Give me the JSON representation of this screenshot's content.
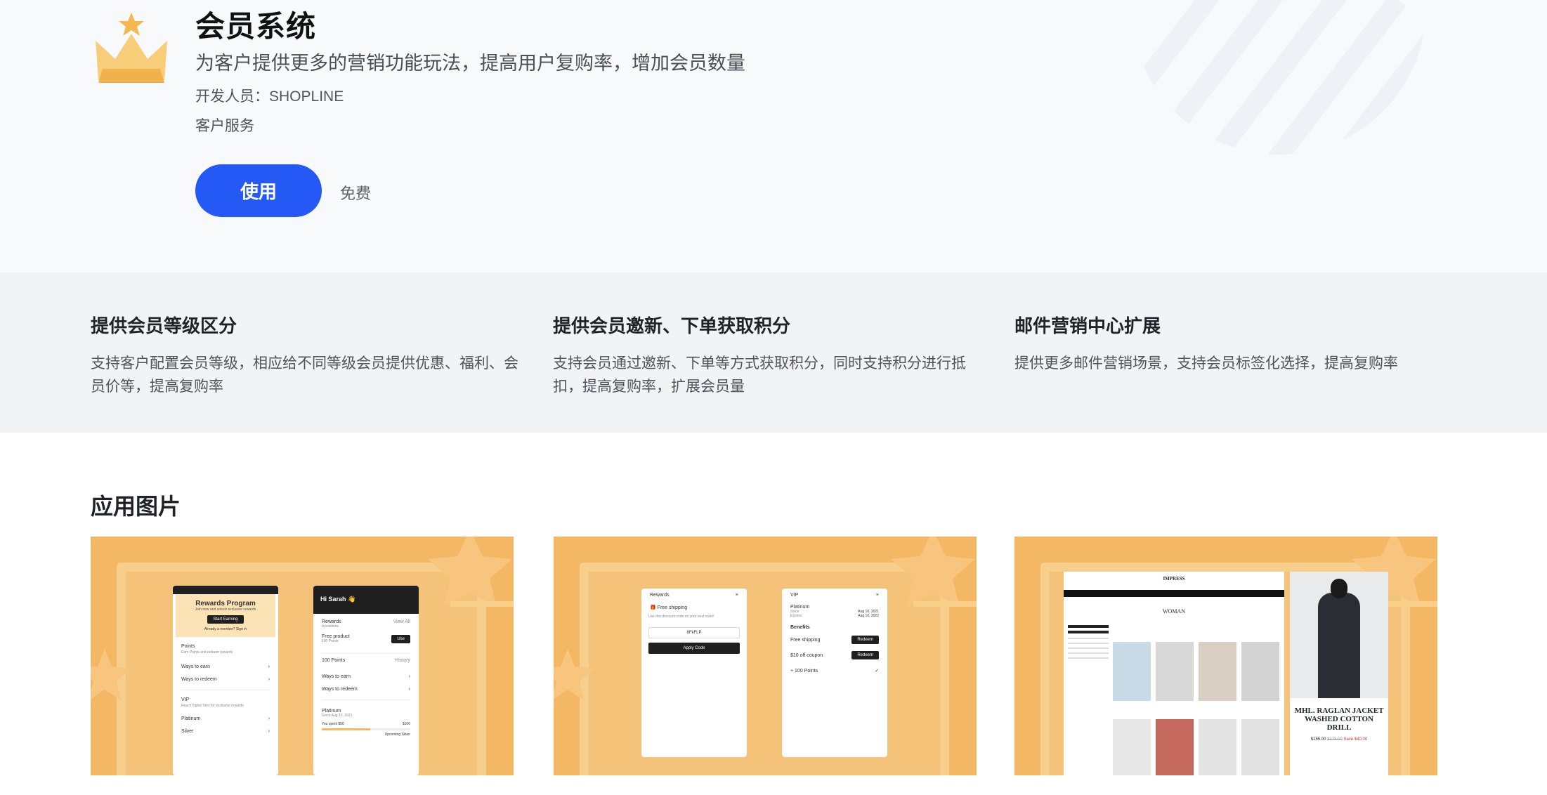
{
  "app": {
    "title": "会员系统",
    "description": "为客户提供更多的营销功能玩法，提高用户复购率，增加会员数量",
    "developer": "开发人员：SHOPLINE",
    "service": "客户服务",
    "use_label": "使用",
    "price": "免费"
  },
  "features": [
    {
      "title": "提供会员等级区分",
      "desc": "支持客户配置会员等级，相应给不同等级会员提供优惠、福利、会员价等，提高复购率"
    },
    {
      "title": "提供会员邀新、下单获取积分",
      "desc": "支持会员通过邀新、下单等方式获取积分，同时支持积分进行抵扣，提高复购率，扩展会员量"
    },
    {
      "title": "邮件营销中心扩展",
      "desc": "提供更多邮件营销场景，支持会员标签化选择，提高复购率"
    }
  ],
  "gallery": {
    "title": "应用图片",
    "shot1": {
      "left_panel": {
        "title": "Rewards Program",
        "subtitle": "Join now and unlock exclusive rewards",
        "cta": "Start Earning",
        "signin": "Already a member? Sign in",
        "points_title": "Points",
        "points_sub": "Earn Points and redeem rewards",
        "ways_earn": "Ways to earn",
        "ways_redeem": "Ways to redeem",
        "vip_title": "VIP",
        "vip_sub": "Reach higher tiers for exclusive rewards",
        "tier1": "Platinum",
        "tier2": "Silver"
      },
      "right_panel": {
        "greeting": "Hi Sarah 👋",
        "rewards": "Rewards",
        "rewards_count": "3 positions",
        "view_all": "View All",
        "free_product": "Free product",
        "free_product_points": "100 Points",
        "use_btn": "Use",
        "points": "100 Points",
        "history": "History",
        "ways_earn": "Ways to earn",
        "ways_redeem": "Ways to redeem",
        "tier": "Platinum",
        "tier_since": "Since Aug 10, 2021",
        "spent": "You spent $50",
        "spent_goal": "$100",
        "upcoming": "Upcoming",
        "upcoming_tier": "Silver"
      }
    },
    "shot2": {
      "left_panel": {
        "back": "Rewards",
        "item": "Free shipping",
        "hint": "Use this discount code on your next order!",
        "code": "8FkFLP",
        "apply": "Apply Code"
      },
      "right_panel": {
        "back": "VIP",
        "tier": "Platinum",
        "since_label": "Since",
        "since_date": "Aug 10, 2021",
        "expires_label": "Expires",
        "expires_date": "Aug 10, 2022",
        "benefits": "Benefits",
        "benefit1": "Free shipping",
        "benefit2": "$10 off coupon",
        "benefit3": "+ 100 Points",
        "redeem": "Redeem"
      }
    },
    "shot3": {
      "store_name": "IMPRESS",
      "category": "WOMAN",
      "product_title": "MHL. RAGLAN JACKET WASHED COTTON DRILL",
      "price_current": "$155.00",
      "price_old": "$175.00",
      "save": "Save $40.00"
    }
  },
  "colors": {
    "primary": "#2459f5",
    "crown": "#f5c063",
    "shot_bg": "#f4b763"
  }
}
